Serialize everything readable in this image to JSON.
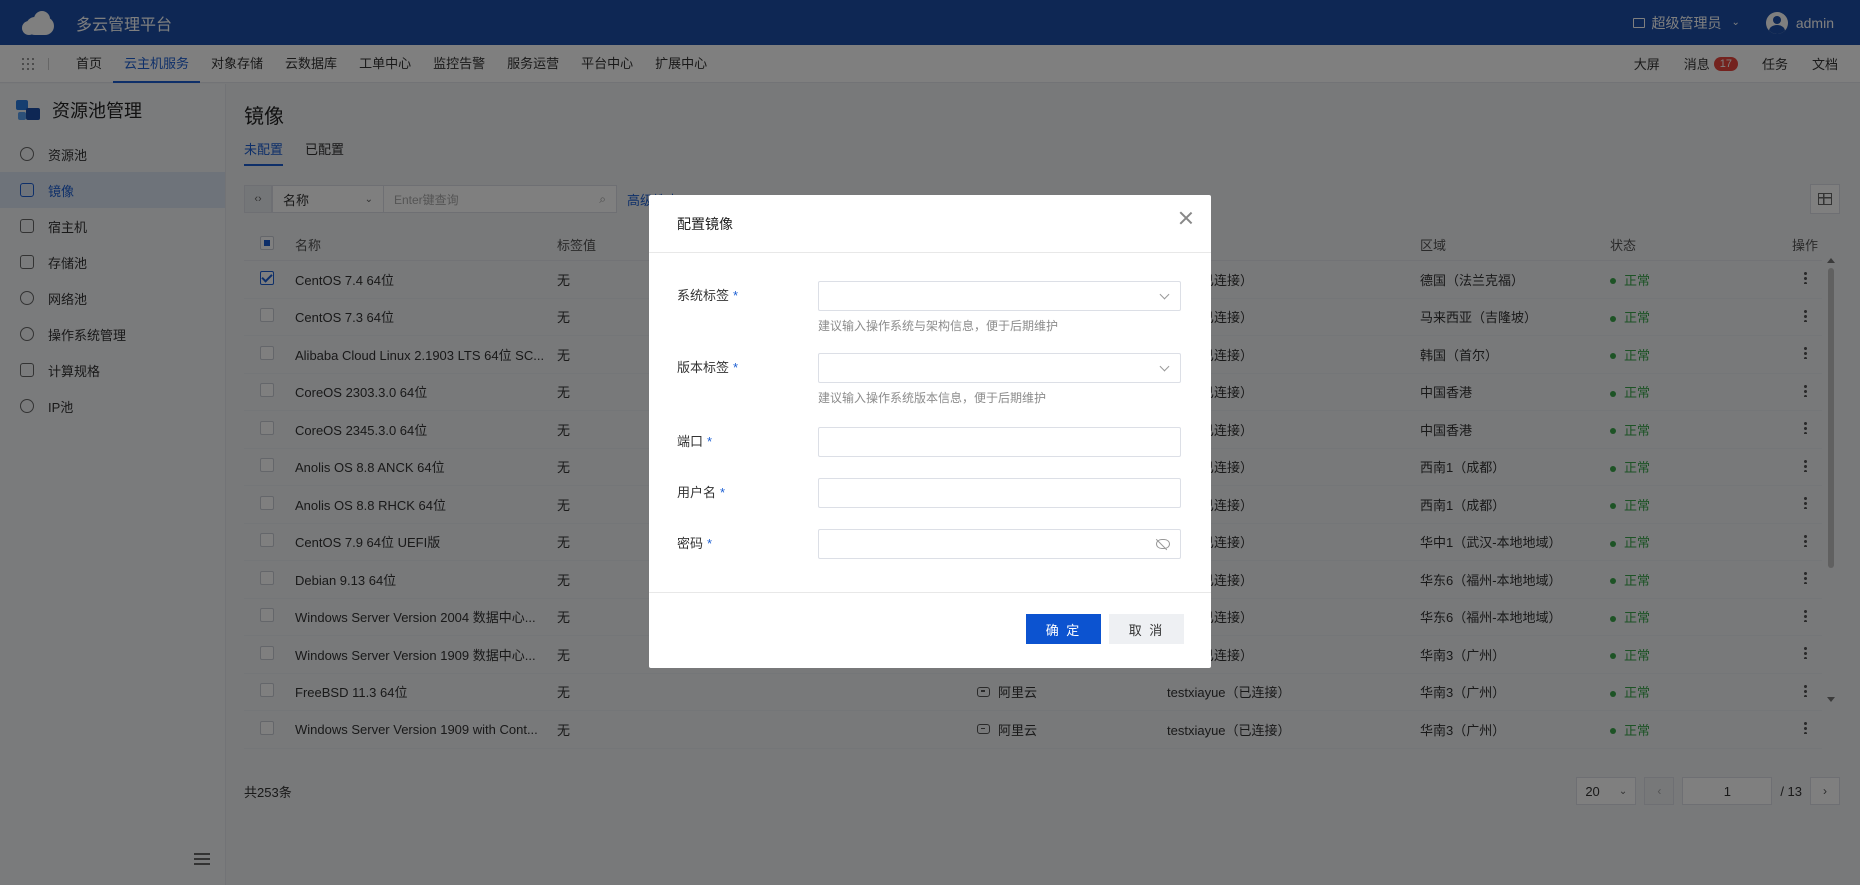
{
  "app": {
    "title": "多云管理平台",
    "role": "超级管理员",
    "user": "admin"
  },
  "nav": {
    "items": [
      "首页",
      "云主机服务",
      "对象存储",
      "云数据库",
      "工单中心",
      "监控告警",
      "服务运营",
      "平台中心",
      "扩展中心"
    ],
    "active_index": 1,
    "right": {
      "screen": "大屏",
      "messages": "消息",
      "message_count": "17",
      "tasks": "任务",
      "docs": "文档"
    }
  },
  "sidebar": {
    "title": "资源池管理",
    "items": [
      {
        "label": "资源池",
        "icon": "resource-pool-icon"
      },
      {
        "label": "镜像",
        "icon": "image-icon",
        "active": true
      },
      {
        "label": "宿主机",
        "icon": "host-icon"
      },
      {
        "label": "存储池",
        "icon": "storage-icon"
      },
      {
        "label": "网络池",
        "icon": "network-icon"
      },
      {
        "label": "操作系统管理",
        "icon": "os-icon"
      },
      {
        "label": "计算规格",
        "icon": "compute-spec-icon"
      },
      {
        "label": "IP池",
        "icon": "ip-pool-icon"
      }
    ]
  },
  "page": {
    "title": "镜像",
    "tabs": [
      "未配置",
      "已配置"
    ],
    "search": {
      "field": "名称",
      "placeholder": "Enter键查询",
      "advanced": "高级搜索"
    }
  },
  "table": {
    "headers": {
      "name": "名称",
      "tag": "标签值",
      "region": "区域",
      "status": "状态",
      "op": "操作"
    },
    "rows": [
      {
        "name": "CentOS 7.4 64位",
        "tag": "无",
        "acct": "yue（已连接）",
        "region": "德国（法兰克福）",
        "status": "正常",
        "checked": true
      },
      {
        "name": "CentOS 7.3 64位",
        "tag": "无",
        "acct": "yue（已连接）",
        "region": "马来西亚（吉隆坡）",
        "status": "正常"
      },
      {
        "name": "Alibaba Cloud Linux 2.1903 LTS 64位 SC...",
        "tag": "无",
        "acct": "yue（已连接）",
        "region": "韩国（首尔）",
        "status": "正常"
      },
      {
        "name": "CoreOS 2303.3.0 64位",
        "tag": "无",
        "acct": "yue（已连接）",
        "region": "中国香港",
        "status": "正常"
      },
      {
        "name": "CoreOS 2345.3.0 64位",
        "tag": "无",
        "acct": "yue（已连接）",
        "region": "中国香港",
        "status": "正常"
      },
      {
        "name": "Anolis OS 8.8 ANCK 64位",
        "tag": "无",
        "acct": "yue（已连接）",
        "region": "西南1（成都）",
        "status": "正常"
      },
      {
        "name": "Anolis OS 8.8 RHCK 64位",
        "tag": "无",
        "acct": "yue（已连接）",
        "region": "西南1（成都）",
        "status": "正常"
      },
      {
        "name": "CentOS 7.9 64位 UEFI版",
        "tag": "无",
        "acct": "yue（已连接）",
        "region": "华中1（武汉-本地地域）",
        "status": "正常"
      },
      {
        "name": "Debian 9.13 64位",
        "tag": "无",
        "acct": "yue（已连接）",
        "region": "华东6（福州-本地地域）",
        "status": "正常"
      },
      {
        "name": "Windows Server Version 2004 数据中心...",
        "tag": "无",
        "acct": "yue（已连接）",
        "region": "华东6（福州-本地地域）",
        "status": "正常"
      },
      {
        "name": "Windows Server Version 1909 数据中心...",
        "tag": "无",
        "acct": "yue（已连接）",
        "region": "华南3（广州）",
        "status": "正常"
      },
      {
        "name": "FreeBSD 11.3 64位",
        "tag": "无",
        "platform": "阿里云",
        "acct": "testxiayue（已连接）",
        "region": "华南3（广州）",
        "status": "正常"
      },
      {
        "name": "Windows Server Version 1909 with Cont...",
        "tag": "无",
        "platform": "阿里云",
        "acct": "testxiayue（已连接）",
        "region": "华南3（广州）",
        "status": "正常"
      }
    ]
  },
  "footer": {
    "total": "共253条",
    "page_size": "20",
    "current_page": "1",
    "total_pages": "/ 13"
  },
  "modal": {
    "title": "配置镜像",
    "fields": {
      "os_tag": {
        "label": "系统标签",
        "hint": "建议输入操作系统与架构信息，便于后期维护"
      },
      "version_tag": {
        "label": "版本标签",
        "hint": "建议输入操作系统版本信息，便于后期维护"
      },
      "port": {
        "label": "端口"
      },
      "username": {
        "label": "用户名"
      },
      "password": {
        "label": "密码"
      }
    },
    "required_mark": "*",
    "ok": "确 定",
    "cancel": "取 消"
  }
}
